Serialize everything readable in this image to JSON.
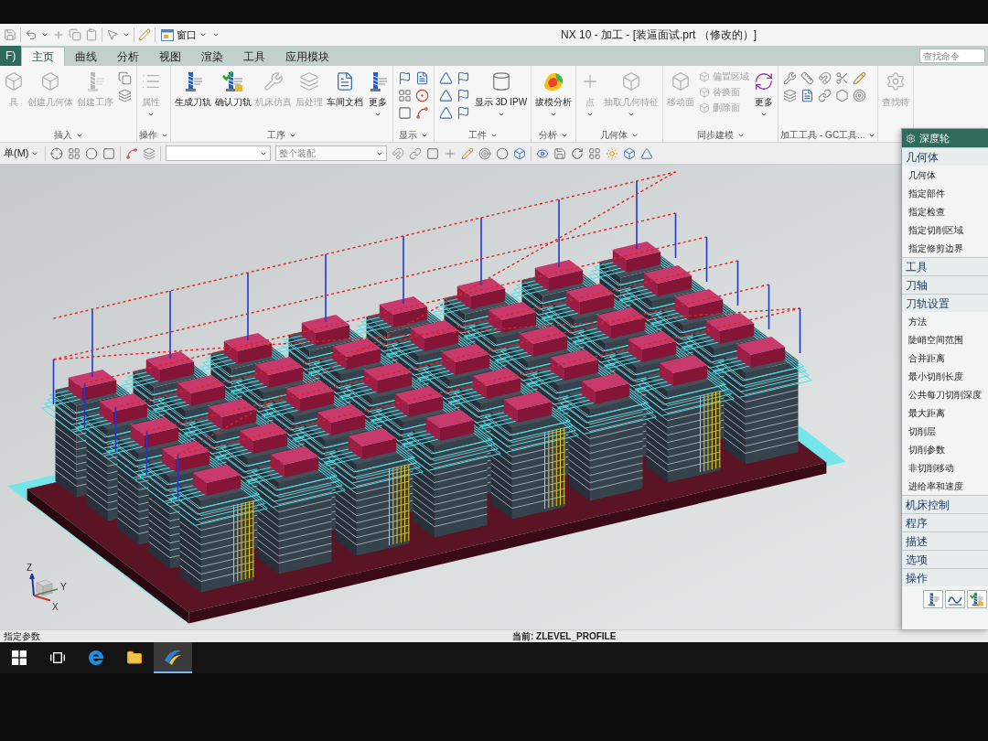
{
  "quick_access": {
    "window_button": "窗口"
  },
  "window": {
    "title": "NX 10 - 加工 - [装逼面试.prt （修改的）]"
  },
  "tabs": [
    {
      "label": "F)",
      "kind": "file",
      "selected": false
    },
    {
      "label": "主页",
      "kind": "tab",
      "selected": true
    },
    {
      "label": "曲线",
      "kind": "tab",
      "selected": false
    },
    {
      "label": "分析",
      "kind": "tab",
      "selected": false
    },
    {
      "label": "视图",
      "kind": "tab",
      "selected": false
    },
    {
      "label": "渲染",
      "kind": "tab",
      "selected": false
    },
    {
      "label": "工具",
      "kind": "tab",
      "selected": false
    },
    {
      "label": "应用模块",
      "kind": "tab",
      "selected": false
    }
  ],
  "command_search": {
    "placeholder": "查找命令"
  },
  "ribbon": {
    "groups": [
      {
        "label": "插入",
        "items": [
          {
            "kind": "large",
            "label": "具",
            "disabled": true,
            "dropdown": false
          },
          {
            "kind": "large",
            "label": "创建几何体",
            "disabled": true,
            "dropdown": false
          },
          {
            "kind": "large",
            "label": "创建工序",
            "disabled": true,
            "dropdown": false
          },
          {
            "kind": "tools"
          }
        ]
      },
      {
        "label": "操作",
        "items": [
          {
            "kind": "large",
            "label": "属性",
            "disabled": true,
            "dropdown": true
          }
        ]
      },
      {
        "label": "工序",
        "items": [
          {
            "kind": "large",
            "label": "生成刀轨",
            "disabled": false,
            "dropdown": false
          },
          {
            "kind": "large",
            "label": "确认刀轨",
            "disabled": false,
            "dropdown": false
          },
          {
            "kind": "large",
            "label": "机床仿真",
            "disabled": true,
            "dropdown": false
          },
          {
            "kind": "large",
            "label": "后处理",
            "disabled": true,
            "dropdown": false
          },
          {
            "kind": "large",
            "label": "车间文档",
            "disabled": false,
            "dropdown": false
          },
          {
            "kind": "large",
            "label": "更多",
            "disabled": false,
            "dropdown": true
          }
        ]
      },
      {
        "label": "显示",
        "items": [
          {
            "kind": "tools"
          }
        ]
      },
      {
        "label": "工件",
        "items": [
          {
            "kind": "tools"
          },
          {
            "kind": "large",
            "label": "显示 3D IPW",
            "disabled": false,
            "dropdown": true
          }
        ]
      },
      {
        "label": "分析",
        "items": [
          {
            "kind": "large",
            "label": "拔模分析",
            "disabled": false,
            "dropdown": true
          }
        ]
      },
      {
        "label": "几何体",
        "items": [
          {
            "kind": "large",
            "label": "点",
            "disabled": true,
            "dropdown": true
          },
          {
            "kind": "large",
            "label": "抽取几何特征",
            "disabled": true,
            "dropdown": true
          }
        ]
      },
      {
        "label": "同步建模",
        "items": [
          {
            "kind": "large",
            "label": "移动面",
            "disabled": true,
            "dropdown": false
          },
          {
            "kind": "stack",
            "entries": [
              {
                "label": "偏置区域",
                "disabled": true
              },
              {
                "label": "替换面",
                "disabled": true
              },
              {
                "label": "删除面",
                "disabled": true
              }
            ]
          },
          {
            "kind": "large",
            "label": "更多",
            "disabled": false,
            "dropdown": true
          }
        ]
      },
      {
        "label": "加工工具 - GC工具...",
        "items": [
          {
            "kind": "tools"
          }
        ]
      },
      {
        "items": [
          {
            "kind": "large",
            "label": "查找特",
            "disabled": true,
            "dropdown": false
          }
        ]
      }
    ]
  },
  "toolbar": {
    "menu_label": "单(M)",
    "assembly_scope": "整个装配"
  },
  "viewport": {
    "triad": {
      "z": "Z",
      "y": "Y",
      "x": "X"
    }
  },
  "dialog": {
    "title": "深度轮",
    "sections": [
      {
        "label": "几何体",
        "kind": "list",
        "items": [
          "几何体",
          "指定部件",
          "指定检查",
          "指定切削区域",
          "指定修剪边界"
        ]
      },
      {
        "label": "工具",
        "kind": "list"
      },
      {
        "label": "刀轴",
        "kind": "list"
      },
      {
        "label": "刀轨设置",
        "kind": "list",
        "items": [
          "方法",
          "陡峭空间范围",
          "合并距离",
          "最小切削长度",
          "公共每刀切削深度",
          "最大距离",
          "切削层",
          "切削参数",
          "非切削移动",
          "进给率和速度"
        ]
      },
      {
        "label": "机床控制",
        "kind": "list"
      },
      {
        "label": "程序",
        "kind": "list"
      },
      {
        "label": "描述",
        "kind": "list"
      },
      {
        "label": "选项",
        "kind": "list"
      },
      {
        "label": "操作",
        "kind": "actions"
      }
    ]
  },
  "status_bar": {
    "prompt": "指定参数",
    "current": "当前: ZLEVEL_PROFILE"
  },
  "taskbar": [
    {
      "kind": "start",
      "selected": false
    },
    {
      "kind": "taskview",
      "selected": false
    },
    {
      "kind": "browser",
      "selected": false
    },
    {
      "kind": "folder",
      "selected": false
    },
    {
      "kind": "app",
      "selected": true
    }
  ]
}
